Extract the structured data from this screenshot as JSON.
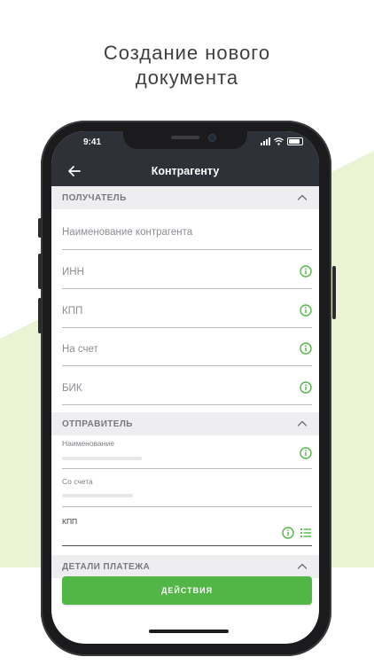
{
  "headline": {
    "line1": "Создание нового",
    "line2": "документа"
  },
  "status_bar": {
    "time": "9:41"
  },
  "nav": {
    "title": "Контрагенту"
  },
  "sections": {
    "recipient": {
      "title": "ПОЛУЧАТЕЛЬ",
      "expanded": true
    },
    "sender": {
      "title": "ОТПРАВИТЕЛЬ",
      "expanded": true
    },
    "payment_details": {
      "title": "ДЕТАЛИ ПЛАТЕЖА",
      "expanded": false
    }
  },
  "recipient_fields": {
    "counterparty_name": {
      "placeholder": "Наименование контрагента"
    },
    "inn": {
      "placeholder": "ИНН"
    },
    "kpp": {
      "placeholder": "КПП"
    },
    "account": {
      "placeholder": "На счет"
    },
    "bik": {
      "placeholder": "БИК"
    }
  },
  "sender_fields": {
    "name": {
      "label": "Наименование"
    },
    "from_account": {
      "label": "Со счета"
    },
    "kpp": {
      "label": "КПП"
    }
  },
  "actions": {
    "button_label": "ДЕЙСТВИЯ"
  },
  "colors": {
    "accent_green": "#52b647",
    "info_icon_green": "#52b647",
    "nav_background": "#2e3137",
    "section_header_background": "#eeeef0",
    "background_shape": "#e9f3d2"
  },
  "icons": {
    "back": "arrow-left-icon",
    "collapse": "chevron-up-icon",
    "info": "info-circle-icon",
    "list": "list-icon"
  }
}
